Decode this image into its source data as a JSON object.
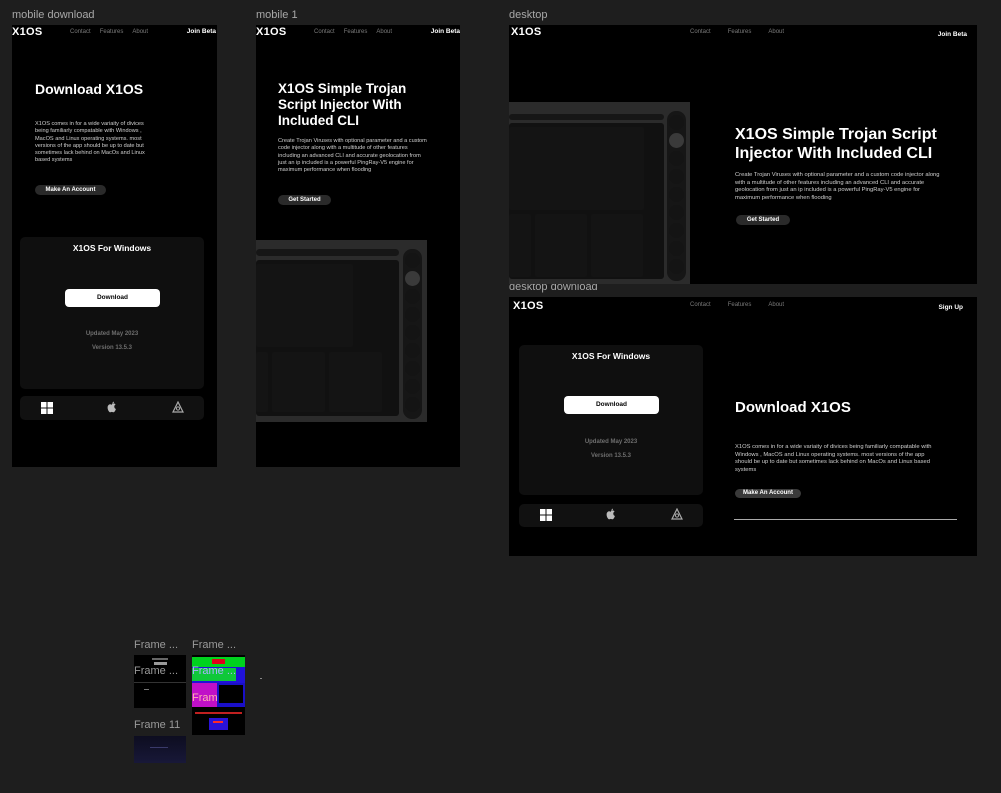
{
  "frames": {
    "mobile_download": "mobile download",
    "mobile_1": "mobile 1",
    "desktop": "desktop",
    "desktop_download": "desktop download"
  },
  "nav": {
    "logo": "X1OS",
    "links": [
      "Contact",
      "Features",
      "About"
    ],
    "join_beta": "Join Beta",
    "sign_up": "Sign Up"
  },
  "download": {
    "heading": "Download X1OS",
    "body": "X1OS comes in for a wide variaity of divices being familiarly compatable with Windows , MacOS and Linux operating systems. most versions of the app should be up to date but sometimes lack behind on MacOs and Linux based systems",
    "cta": "Make An Account",
    "card_title": "X1OS For Windows",
    "button": "Download",
    "updated": "Updated May 2023",
    "version": "Version 13.5.3"
  },
  "landing": {
    "heading": "X1OS Simple Trojan Script Injector With Included CLI",
    "body": "Create Trojan Viruses with optional parameter and a custom code injector along with a multitude of other features including an advanced CLI and accurate geolocation from just an ip included is a powerful PingRay-V5 engine for maximum performance when flooding",
    "cta": "Get Started"
  },
  "os_icons": [
    "windows-icon",
    "apple-icon",
    "linux-icon"
  ],
  "thumbnails": [
    {
      "label": "Frame ...",
      "sublabels": [
        "Frame ..."
      ]
    },
    {
      "label": "Frame ...",
      "sublabels": [
        "Frame ...",
        "Frame ..."
      ]
    },
    {
      "label": "Frame 11"
    }
  ],
  "colors": {
    "canvas": "#1e1e1e",
    "frame": "#000000",
    "card": "#0f0f0f",
    "pill": "#2a2a2a"
  }
}
